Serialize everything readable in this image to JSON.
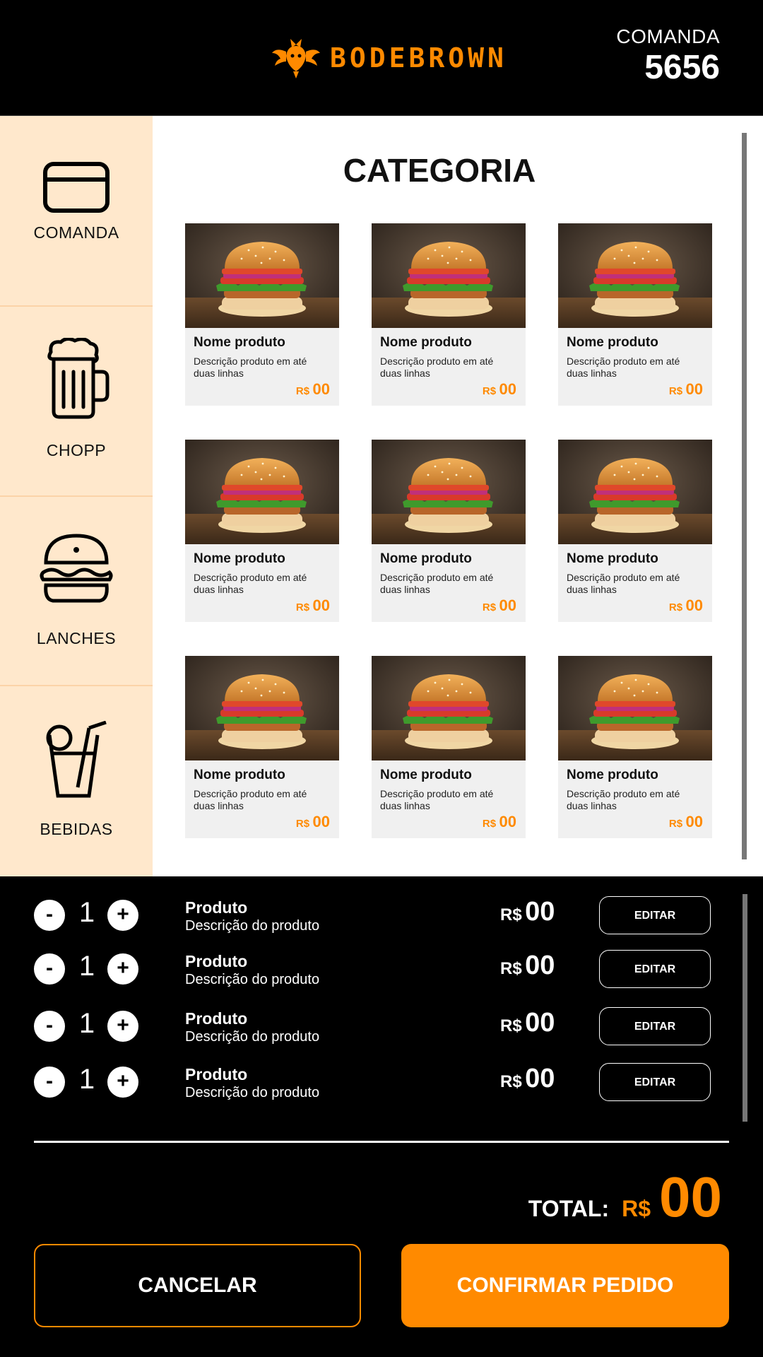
{
  "header": {
    "brand": "BODEBROWN",
    "logo_icon": "goat-dragon-logo-icon",
    "comanda_label": "COMANDA",
    "comanda_number": "5656"
  },
  "sidebar": {
    "items": [
      {
        "label": "COMANDA",
        "icon": "card-icon"
      },
      {
        "label": "CHOPP",
        "icon": "beer-mug-icon"
      },
      {
        "label": "LANCHES",
        "icon": "burger-icon"
      },
      {
        "label": "BEBIDAS",
        "icon": "drink-glass-icon"
      }
    ]
  },
  "main": {
    "title": "CATEGORIA",
    "products": [
      {
        "name": "Nome produto",
        "desc": "Descrição produto em até duas linhas",
        "currency": "R$",
        "price": "00"
      },
      {
        "name": "Nome produto",
        "desc": "Descrição produto em até duas linhas",
        "currency": "R$",
        "price": "00"
      },
      {
        "name": "Nome produto",
        "desc": "Descrição produto em até duas linhas",
        "currency": "R$",
        "price": "00"
      },
      {
        "name": "Nome produto",
        "desc": "Descrição produto em até duas linhas",
        "currency": "R$",
        "price": "00"
      },
      {
        "name": "Nome produto",
        "desc": "Descrição produto em até duas linhas",
        "currency": "R$",
        "price": "00"
      },
      {
        "name": "Nome produto",
        "desc": "Descrição produto em até duas linhas",
        "currency": "R$",
        "price": "00"
      },
      {
        "name": "Nome produto",
        "desc": "Descrição produto em até duas linhas",
        "currency": "R$",
        "price": "00"
      },
      {
        "name": "Nome produto",
        "desc": "Descrição produto em até duas linhas",
        "currency": "R$",
        "price": "00"
      },
      {
        "name": "Nome produto",
        "desc": "Descrição produto em até duas linhas",
        "currency": "R$",
        "price": "00"
      }
    ]
  },
  "order": {
    "items": [
      {
        "minus": "-",
        "qty": "1",
        "plus": "+",
        "name": "Produto",
        "desc": "Descrição do produto",
        "currency": "R$",
        "price": "00",
        "edit": "EDITAR"
      },
      {
        "minus": "-",
        "qty": "1",
        "plus": "+",
        "name": "Produto",
        "desc": "Descrição do produto",
        "currency": "R$",
        "price": "00",
        "edit": "EDITAR"
      },
      {
        "minus": "-",
        "qty": "1",
        "plus": "+",
        "name": "Produto",
        "desc": "Descrição do produto",
        "currency": "R$",
        "price": "00",
        "edit": "EDITAR"
      },
      {
        "minus": "-",
        "qty": "1",
        "plus": "+",
        "name": "Produto",
        "desc": "Descrição do produto",
        "currency": "R$",
        "price": "00",
        "edit": "EDITAR"
      }
    ],
    "total_label": "TOTAL:",
    "total_currency": "R$",
    "total_value": "00",
    "cancel_label": "CANCELAR",
    "confirm_label": "CONFIRMAR PEDIDO"
  },
  "colors": {
    "accent": "#ff8a00",
    "sidebar_bg": "#ffe8cc",
    "card_bg": "#f0f0f0"
  }
}
